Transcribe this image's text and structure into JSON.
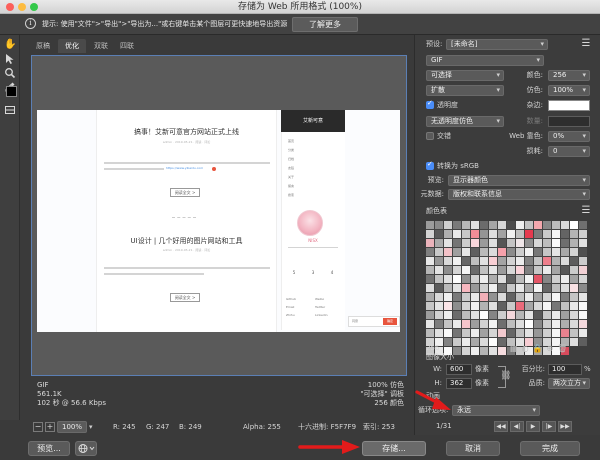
{
  "window": {
    "title": "存储为 Web 所用格式 (100%)",
    "traffic_colors": [
      "#fc605b",
      "#fdbc40",
      "#34c84a"
    ]
  },
  "hint": {
    "text": "提示: 使用\"文件\">\"导出\">\"导出为...\"或右键单击某个图层可更快速地导出资源",
    "learn_more": "了解更多"
  },
  "tools": [
    {
      "name": "hand-tool",
      "glyph": "✋"
    },
    {
      "name": "slice-select-tool",
      "glyph": "↖"
    },
    {
      "name": "zoom-tool",
      "glyph": "⌕"
    },
    {
      "name": "eyedropper-tool",
      "glyph": "✎"
    }
  ],
  "tabs": [
    "原稿",
    "优化",
    "双联",
    "四联"
  ],
  "preview": {
    "webpage": {
      "post1_title": "搞事！艾新可意官方网站正式上线",
      "post1_meta": "admin · 2019-05-21 · 阅读 · 评论",
      "post1_link": "https://www.yibaidu.com",
      "read_more": "阅读全文 >",
      "post2_title": "UI设计 | 几个好用的图片网站和工具",
      "post2_meta": "admin · 2019-05-21 · 阅读 · 评论",
      "sidebar_title": "艾新可意",
      "sidebar_items": [
        "首页",
        "分类",
        "归档",
        "友链",
        "关于",
        "留言",
        "搜索"
      ],
      "username": "NISX",
      "stats": [
        "5",
        "3",
        "4"
      ],
      "links": [
        "Github",
        "Weibo",
        "Email",
        "Twitter",
        "Zhihu",
        "Linkedin"
      ],
      "cookie_text": "同意",
      "cookie_button": "确定"
    },
    "info_left": [
      "GIF",
      "561.1K",
      "102 秒 @ 56.6 Kbps"
    ],
    "info_right": [
      "100% 仿色",
      "\"可选择\" 调板",
      "256 颜色"
    ]
  },
  "status": {
    "zoom": "100%",
    "r": "R: 245",
    "g": "G: 247",
    "b": "B: 249",
    "alpha": "Alpha: 255",
    "hex": "十六进制: F5F7F9",
    "index": "索引: 253"
  },
  "buttons": {
    "preview": "预览...",
    "save": "存储...",
    "cancel": "取消",
    "done": "完成"
  },
  "panel": {
    "preset_label": "预设:",
    "preset_value": "[未命名]",
    "format": "GIF",
    "reduction": "可选择",
    "colors_label": "颜色:",
    "colors_value": "256",
    "dither_algo": "扩散",
    "dither_label": "仿色:",
    "dither_value": "100%",
    "transparency_label": "透明度",
    "matte_label": "杂边:",
    "transparency_dither": "无透明度仿色",
    "amount_label": "数量:",
    "interlaced_label": "交错",
    "websnap_label": "Web 靠色:",
    "websnap_value": "0%",
    "lossy_label": "损耗:",
    "lossy_value": "0",
    "convert_srgb": "转换为 sRGB",
    "preview_label": "预览:",
    "preview_value": "显示器颜色",
    "metadata_label": "元数据:",
    "metadata_value": "版权和联系信息",
    "color_table_label": "颜色表",
    "color_count": "256",
    "image_size_label": "图像大小",
    "w_label": "W:",
    "w_value": "600",
    "h_label": "H:",
    "h_value": "362",
    "px_unit": "像素",
    "percent_label": "百分比:",
    "percent_value": "100",
    "percent_unit": "%",
    "quality_label": "品质:",
    "quality_value": "两次立方",
    "animation_label": "动画",
    "loop_label": "循环选项:",
    "loop_value": "永远",
    "frame_counter": "1/31"
  },
  "palette": [
    "#9c9c9c",
    "#8a8a8a",
    "#cfcfcf",
    "#7a7a7a",
    "#b8b8b8",
    "#e2e2e2",
    "#6b6b6b",
    "#a6a6a6",
    "#d6d6d6",
    "#4c4c4c",
    "#efefef",
    "#c2c2c2",
    "#f4a8ae",
    "#888888",
    "#bcbcbc",
    "#dadada",
    "#ffffff",
    "#707070",
    "#d4d4d4",
    "#5a5a5a",
    "#b0b0b0",
    "#e9e9e9",
    "#c8c8c8",
    "#f28d97",
    "#959595",
    "#dedede",
    "#a2a2a2",
    "#f0f0f0",
    "#c0c0c0",
    "#e63a4f",
    "#7c7c7c",
    "#cacaca",
    "#f7f7f7",
    "#646464",
    "#b5b5b5",
    "#d0d0d0",
    "#ebb3bb",
    "#aaaaaa",
    "#e4e4e4",
    "#757575",
    "#cdcdcd",
    "#f9d6db",
    "#9a9a9a",
    "#dfdfdf",
    "#555555",
    "#c4c4c4",
    "#efe6e8",
    "#8f8f8f",
    "#d8d8d8",
    "#bdbdbd",
    "#fbfbfb",
    "#6e6e6e",
    "#b2b2b2",
    "#e0e0e0",
    "#7f7f7f",
    "#c9c9c9",
    "#f3c2c8",
    "#9f9f9f",
    "#e7e7e7",
    "#5f5f5f",
    "#bababa",
    "#dcdcdc",
    "#f6a1ab",
    "#8c8c8c",
    "#cecece",
    "#f2f2f2",
    "#777777",
    "#c6c6c6",
    "#e5e5e5",
    "#a8a8a8",
    "#d3d3d3",
    "#4f4f4f",
    "#e8e8e8",
    "#969696",
    "#d9d9d9",
    "#f1f1f1",
    "#676767",
    "#bfbfbf",
    "#e1e1e1",
    "#f8cfd4",
    "#a4a4a4",
    "#d2d2d2",
    "#ececec",
    "#838383",
    "#c5c5c5",
    "#ee7f8c",
    "#b4b4b4",
    "#dbdbdb",
    "#5d5d5d",
    "#cbcbcb",
    "#b7b7b7",
    "#e3e3e3",
    "#8e8e8e",
    "#d5d5d5",
    "#f5f5f5",
    "#6a6a6a",
    "#c1c1c1",
    "#e6e6e6",
    "#9b9b9b",
    "#d7d7d7",
    "#fad4da",
    "#808080",
    "#c7c7c7",
    "#eaeaea",
    "#a5a5a5",
    "#585858",
    "#cccccc",
    "#f0d0d4",
    "#737373",
    "#c3c3c3",
    "#e0e0e0",
    "#fdfdfd",
    "#919191",
    "#d1d1d1",
    "#eeeeee",
    "#acacac",
    "#dddddd",
    "#626262",
    "#bbbbbb",
    "#f3f3f3",
    "#e45566",
    "#878787",
    "#cfcfcf",
    "#ededed",
    "#a3a3a3",
    "#d6d6d6",
    "#dcdcdc",
    "#5b5b5b",
    "#b9b9b9",
    "#e2e2e2",
    "#f7b7bf",
    "#999999",
    "#d0d0d0",
    "#efefef",
    "#717171",
    "#c8c8c8",
    "#e8e8e8",
    "#a9a9a9",
    "#f4f4f4",
    "#676767",
    "#bebebe",
    "#dedede",
    "#f9e1e4",
    "#8b8b8b",
    "#ababab",
    "#d8d8d8",
    "#f1f1f1",
    "#7b7b7b",
    "#cbcbcb",
    "#e9e9e9",
    "#f2b0b8",
    "#939393",
    "#dadada",
    "#626262",
    "#c0c0c0",
    "#ececec",
    "#a1a1a1",
    "#d4d4d4",
    "#f6f6f6",
    "#7e7e7e",
    "#c5c5c5",
    "#e5e5e5",
    "#c6c6c6",
    "#e4e4e4",
    "#fbe5e8",
    "#8d8d8d",
    "#d3d3d3",
    "#f0f0f0",
    "#b3b3b3",
    "#dfdfdf",
    "#616161",
    "#cacaca",
    "#eb6b7b",
    "#a7a7a7",
    "#d9d9d9",
    "#f5f5f5",
    "#767676",
    "#c2c2c2",
    "#e7e7e7",
    "#fafafa",
    "#9d9d9d",
    "#d2d2d2",
    "#eeeeee",
    "#6c6c6c",
    "#bcbcbc",
    "#e1e1e1",
    "#fcfcfc",
    "#858585",
    "#cdcdcd",
    "#f3d7db",
    "#b6b6b6",
    "#e3e3e3",
    "#595959",
    "#c9c9c9",
    "#ebebeb",
    "#a0a0a0",
    "#d7d7d7",
    "#f8f8f8",
    "#e6e6e6",
    "#7d7d7d",
    "#c4c4c4",
    "#eaeaea",
    "#f5c5cb",
    "#9e9e9e",
    "#d1d1d1",
    "#f2f2f2",
    "#6f6f6f",
    "#bdbdbd",
    "#dddddd",
    "#fefefe",
    "#898989",
    "#cecece",
    "#efefef",
    "#aeaeae",
    "#dbdbdb",
    "#f4d9dd",
    "#bababa",
    "#e0e0e0",
    "#f9f9f9",
    "#747474",
    "#c7c7c7",
    "#ececec",
    "#a2a2a2",
    "#d5d5d5",
    "#f1c9ce",
    "#666666",
    "#bfbfbf",
    "#e2e2e2",
    "#979797",
    "#d0d0d0",
    "#f6f6f6",
    "#e8828f",
    "#c3c3c3",
    "#e9e9e9",
    "#d2d2d2",
    "#f0f0f0",
    "#828282",
    "#cacaca",
    "#ebebeb",
    "#a9a9a9",
    "#dbdbdb",
    "#fdfdfd",
    "#696969",
    "#c1c1c1",
    "#e4e4e4",
    "#f7cdd3",
    "#919191",
    "#d6d6d6",
    "#f3f3f3",
    "#b1b1b1",
    "#dedede",
    "#5e5e5e",
    "#c8c8c8",
    "#e7e7e7",
    "#fafafa",
    "#8a8a8a",
    "#d3d3d3",
    "#efefef",
    "#b5b5b5",
    "#e1e1e1",
    "#f6dde0",
    "#797979",
    "#cccccc",
    "#ededed",
    "#a6a6a6",
    "#d8d8d8",
    "#f8f8f8",
    "#d84b5c"
  ]
}
